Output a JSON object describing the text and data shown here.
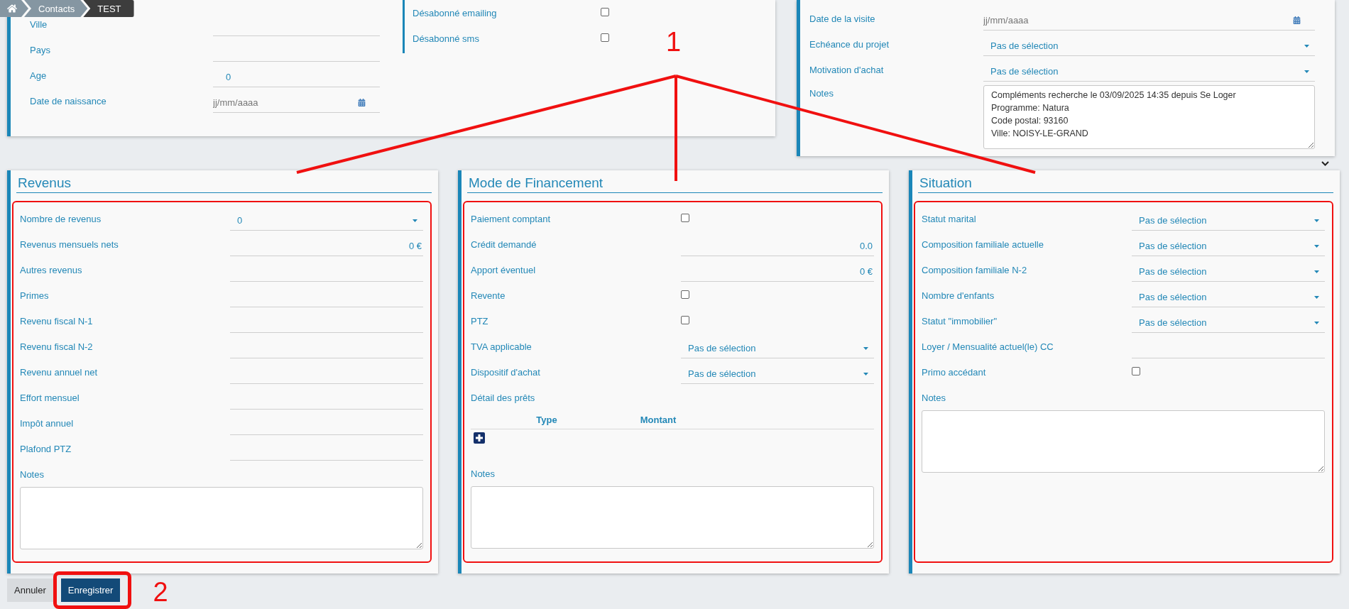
{
  "breadcrumb": [
    {
      "kind": "home"
    },
    {
      "kind": "link",
      "label": "Contacts"
    },
    {
      "kind": "current",
      "label": "TEST"
    }
  ],
  "contact_card": {
    "fields": [
      {
        "kind": "text",
        "label": "Ville"
      },
      {
        "kind": "text",
        "label": "Pays"
      },
      {
        "kind": "number",
        "label": "Age",
        "value": "0"
      },
      {
        "kind": "date",
        "label": "Date de naissance",
        "placeholder": "jj/mm/aaaa"
      }
    ],
    "options": [
      {
        "kind": "checkbox",
        "label": "Désabonné emailing",
        "checked": false
      },
      {
        "kind": "checkbox",
        "label": "Désabonné sms",
        "checked": false
      }
    ]
  },
  "project_card": {
    "fields": [
      {
        "kind": "date",
        "label": "Date de la visite",
        "placeholder": "jj/mm/aaaa"
      },
      {
        "kind": "select",
        "label": "Echéance du projet",
        "value": "Pas de sélection"
      },
      {
        "kind": "select",
        "label": "Motivation d'achat",
        "value": "Pas de sélection"
      },
      {
        "kind": "textarea",
        "label": "Notes",
        "value": "Compléments recherche le 03/09/2025 14:35 depuis Se Loger\nProgramme: Natura\nCode postal: 93160\nVille: NOISY-LE-GRAND"
      }
    ]
  },
  "callout": {
    "label": "1"
  },
  "sections": [
    {
      "title": "Revenus",
      "highlighted": true,
      "fields": [
        {
          "kind": "select",
          "label": "Nombre de revenus",
          "value": "0"
        },
        {
          "kind": "amount",
          "label": "Revenus mensuels nets",
          "value": "0 €"
        },
        {
          "kind": "text",
          "label": "Autres revenus"
        },
        {
          "kind": "text",
          "label": "Primes"
        },
        {
          "kind": "text",
          "label": "Revenu fiscal N-1"
        },
        {
          "kind": "text",
          "label": "Revenu fiscal N-2"
        },
        {
          "kind": "text",
          "label": "Revenu annuel net"
        },
        {
          "kind": "text",
          "label": "Effort mensuel"
        },
        {
          "kind": "text",
          "label": "Impôt annuel"
        },
        {
          "kind": "text",
          "label": "Plafond PTZ"
        },
        {
          "kind": "notes",
          "label": "Notes"
        }
      ]
    },
    {
      "title": "Mode de Financement",
      "highlighted": true,
      "fields": [
        {
          "kind": "checkbox",
          "label": "Paiement comptant",
          "checked": false
        },
        {
          "kind": "amount",
          "label": "Crédit demandé",
          "value": "0.0"
        },
        {
          "kind": "amount",
          "label": "Apport éventuel",
          "value": "0 €"
        },
        {
          "kind": "checkbox",
          "label": "Revente",
          "checked": false
        },
        {
          "kind": "checkbox",
          "label": "PTZ",
          "checked": false
        },
        {
          "kind": "select",
          "label": "TVA applicable",
          "value": "Pas de sélection"
        },
        {
          "kind": "select",
          "label": "Dispositif d'achat",
          "value": "Pas de sélection"
        },
        {
          "kind": "loans",
          "label": "Détail des prêts",
          "columns": [
            "Type",
            "Montant"
          ]
        },
        {
          "kind": "notes",
          "label": "Notes"
        }
      ]
    },
    {
      "title": "Situation",
      "highlighted": true,
      "fields": [
        {
          "kind": "select",
          "label": "Statut marital",
          "value": "Pas de sélection"
        },
        {
          "kind": "select",
          "label": "Composition familiale actuelle",
          "value": "Pas de sélection"
        },
        {
          "kind": "select",
          "label": "Composition familiale N-2",
          "value": "Pas de sélection"
        },
        {
          "kind": "select",
          "label": "Nombre d'enfants",
          "value": "Pas de sélection"
        },
        {
          "kind": "select",
          "label": "Statut \"immobilier\"",
          "value": "Pas de sélection"
        },
        {
          "kind": "text",
          "label": "Loyer / Mensualité actuel(le) CC"
        },
        {
          "kind": "checkbox",
          "label": "Primo accédant",
          "checked": false
        },
        {
          "kind": "notes",
          "label": "Notes"
        }
      ]
    }
  ],
  "actions": [
    {
      "kind": "cancel",
      "label": "Annuler",
      "highlighted": false
    },
    {
      "kind": "save",
      "label": "Enregistrer",
      "highlighted": true,
      "callout": "2"
    }
  ]
}
